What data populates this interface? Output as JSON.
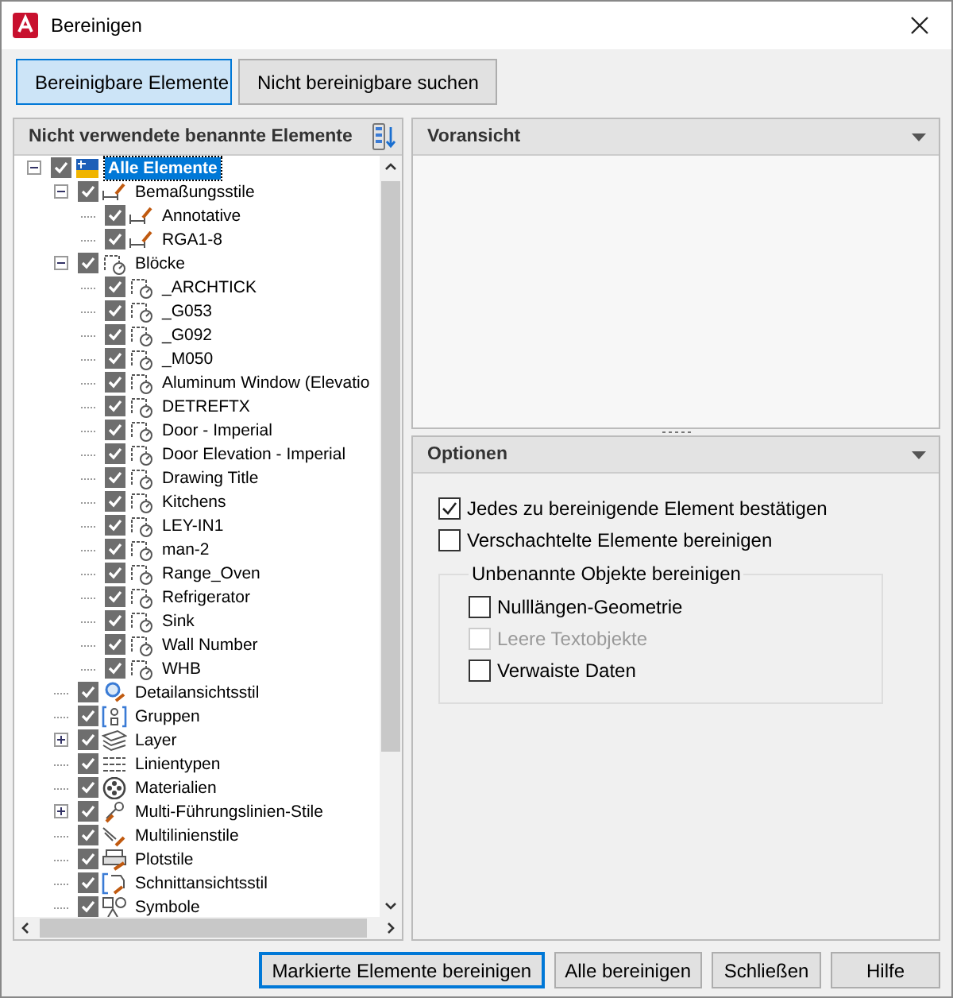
{
  "window": {
    "title": "Bereinigen"
  },
  "modes": [
    {
      "label": "Bereinigbare Elemente",
      "selected": true
    },
    {
      "label": "Nicht bereinigbare suchen",
      "selected": false
    }
  ],
  "tree_panel": {
    "title": "Nicht verwendete benannte Elemente",
    "items": [
      {
        "label": "Alle Elemente",
        "kind": "all",
        "checked": true,
        "selected": true,
        "expanded": true,
        "children": [
          {
            "label": "Bemaßungsstile",
            "kind": "dim",
            "checked": true,
            "selected": false,
            "expanded": true,
            "children": [
              {
                "label": "Annotative",
                "kind": "dim",
                "checked": true,
                "selected": false
              },
              {
                "label": "RGA1-8",
                "kind": "dim",
                "checked": true,
                "selected": false
              }
            ]
          },
          {
            "label": "Blöcke",
            "kind": "block",
            "checked": true,
            "selected": false,
            "expanded": true,
            "children": [
              {
                "label": "_ARCHTICK",
                "kind": "block",
                "checked": true,
                "selected": false
              },
              {
                "label": "_G053",
                "kind": "block",
                "checked": true,
                "selected": false
              },
              {
                "label": "_G092",
                "kind": "block",
                "checked": true,
                "selected": false
              },
              {
                "label": "_M050",
                "kind": "block",
                "checked": true,
                "selected": false
              },
              {
                "label": "Aluminum Window (Elevatio",
                "kind": "block",
                "checked": true,
                "selected": false
              },
              {
                "label": "DETREFTX",
                "kind": "block",
                "checked": true,
                "selected": false
              },
              {
                "label": "Door - Imperial",
                "kind": "block",
                "checked": true,
                "selected": false
              },
              {
                "label": "Door Elevation - Imperial",
                "kind": "block",
                "checked": true,
                "selected": false
              },
              {
                "label": "Drawing Title",
                "kind": "block",
                "checked": true,
                "selected": false
              },
              {
                "label": "Kitchens",
                "kind": "block",
                "checked": true,
                "selected": false
              },
              {
                "label": "LEY-IN1",
                "kind": "block",
                "checked": true,
                "selected": false
              },
              {
                "label": "man-2",
                "kind": "block",
                "checked": true,
                "selected": false
              },
              {
                "label": "Range_Oven",
                "kind": "block",
                "checked": true,
                "selected": false
              },
              {
                "label": "Refrigerator",
                "kind": "block",
                "checked": true,
                "selected": false
              },
              {
                "label": "Sink",
                "kind": "block",
                "checked": true,
                "selected": false
              },
              {
                "label": "Wall Number",
                "kind": "block",
                "checked": true,
                "selected": false
              },
              {
                "label": "WHB",
                "kind": "block",
                "checked": true,
                "selected": false
              }
            ]
          },
          {
            "label": "Detailansichtsstil",
            "kind": "detail",
            "checked": true,
            "selected": false
          },
          {
            "label": "Gruppen",
            "kind": "group",
            "checked": true,
            "selected": false
          },
          {
            "label": "Layer",
            "kind": "layer",
            "checked": true,
            "selected": false,
            "expanded": false
          },
          {
            "label": "Linientypen",
            "kind": "linetype",
            "checked": true,
            "selected": false
          },
          {
            "label": "Materialien",
            "kind": "material",
            "checked": true,
            "selected": false
          },
          {
            "label": "Multi-Führungslinien-Stile",
            "kind": "mleader",
            "checked": true,
            "selected": false,
            "expanded": false
          },
          {
            "label": "Multilinienstile",
            "kind": "mline",
            "checked": true,
            "selected": false
          },
          {
            "label": "Plotstile",
            "kind": "plot",
            "checked": true,
            "selected": false
          },
          {
            "label": "Schnittansichtsstil",
            "kind": "section",
            "checked": true,
            "selected": false
          },
          {
            "label": "Symbole",
            "kind": "symbol",
            "checked": true,
            "selected": false
          }
        ]
      }
    ]
  },
  "preview_panel": {
    "title": "Voransicht"
  },
  "options_panel": {
    "title": "Optionen",
    "options": [
      {
        "label": "Jedes zu bereinigende Element bestätigen",
        "checked": true,
        "disabled": false
      },
      {
        "label": "Verschachtelte Elemente bereinigen",
        "checked": false,
        "disabled": false
      }
    ],
    "group": {
      "title": "Unbenannte Objekte bereinigen",
      "options": [
        {
          "label": "Nulllängen-Geometrie",
          "checked": false,
          "disabled": false
        },
        {
          "label": "Leere Textobjekte",
          "checked": false,
          "disabled": true
        },
        {
          "label": "Verwaiste Daten",
          "checked": false,
          "disabled": false
        }
      ]
    }
  },
  "buttons": [
    {
      "label": "Markierte Elemente bereinigen",
      "default": true
    },
    {
      "label": "Alle bereinigen",
      "default": false
    },
    {
      "label": "Schließen",
      "default": false
    },
    {
      "label": "Hilfe",
      "default": false
    }
  ]
}
